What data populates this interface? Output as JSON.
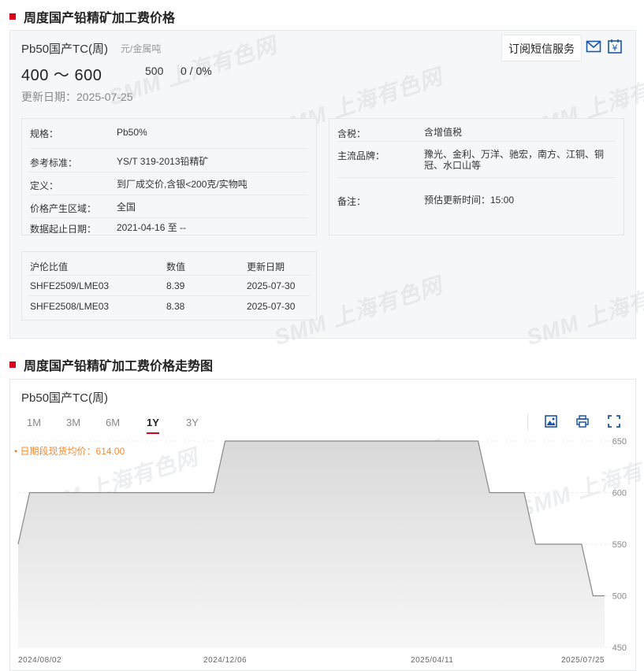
{
  "section1": {
    "title": "周度国产铅精矿加工费价格"
  },
  "product": {
    "name": "Pb50国产TC(周)",
    "unit": "元/金属吨",
    "price_range": "400 ～ 600",
    "mid_price": "500",
    "change": "0 / 0%",
    "update_date": "更新日期：2025-07-25",
    "subscribe_label": "订阅短信服务"
  },
  "watermark": "SMM 上海有色网",
  "info_left": [
    {
      "key": "规格：",
      "value": "Pb50%"
    },
    {
      "key": "参考标准：",
      "value": "YS/T 319-2013铅精矿"
    },
    {
      "key": "定义：",
      "value": "到厂成交价,含银<200克/实物吨"
    },
    {
      "key": "价格产生区域：",
      "value": "全国"
    },
    {
      "key": "数据起止日期：",
      "value": "2021-04-16 至 --"
    }
  ],
  "info_right": [
    {
      "key": "含税：",
      "value": "含增值税"
    },
    {
      "key": "主流品牌：",
      "value": "豫光、金利、万洋、驰宏，南方、江铜、铜冠、水口山等"
    },
    {
      "key": "备注：",
      "value": "预估更新时间：15:00"
    }
  ],
  "ratio_table": {
    "headers": [
      "沪伦比值",
      "数值",
      "更新日期"
    ],
    "rows": [
      [
        "SHFE2509/LME03",
        "8.39",
        "2025-07-30"
      ],
      [
        "SHFE2508/LME03",
        "8.38",
        "2025-07-30"
      ]
    ]
  },
  "section2": {
    "title": "周度国产铅精矿加工费价格走势图"
  },
  "chart": {
    "title": "Pb50国产TC(周)",
    "ranges": [
      "1M",
      "3M",
      "6M",
      "1Y",
      "3Y"
    ],
    "active_range": "1Y",
    "avg_label": "• 日期段现货均价：614.00"
  },
  "chart_data": {
    "type": "area",
    "title": "Pb50国产TC(周)",
    "x": [
      "2024-08-02",
      "2024-08-09",
      "2024-11-29",
      "2024-12-06",
      "2025-05-09",
      "2025-05-16",
      "2025-06-06",
      "2025-06-13",
      "2025-07-11",
      "2025-07-18",
      "2025-07-25"
    ],
    "y": [
      550,
      600,
      600,
      650,
      650,
      600,
      600,
      550,
      550,
      500,
      500
    ],
    "x_tick_labels": [
      "2024/08/02",
      "2024/12/06",
      "2025/04/11",
      "2025/07/25"
    ],
    "y_tick_labels": [
      "450",
      "500",
      "550",
      "600",
      "650"
    ],
    "ylim": [
      450,
      650
    ],
    "color": "#888888",
    "fill": "#e8e8e8"
  },
  "colors": {
    "accent": "#d9001b",
    "icon_blue": "#1a56a7",
    "avg_orange": "#f28c38"
  }
}
